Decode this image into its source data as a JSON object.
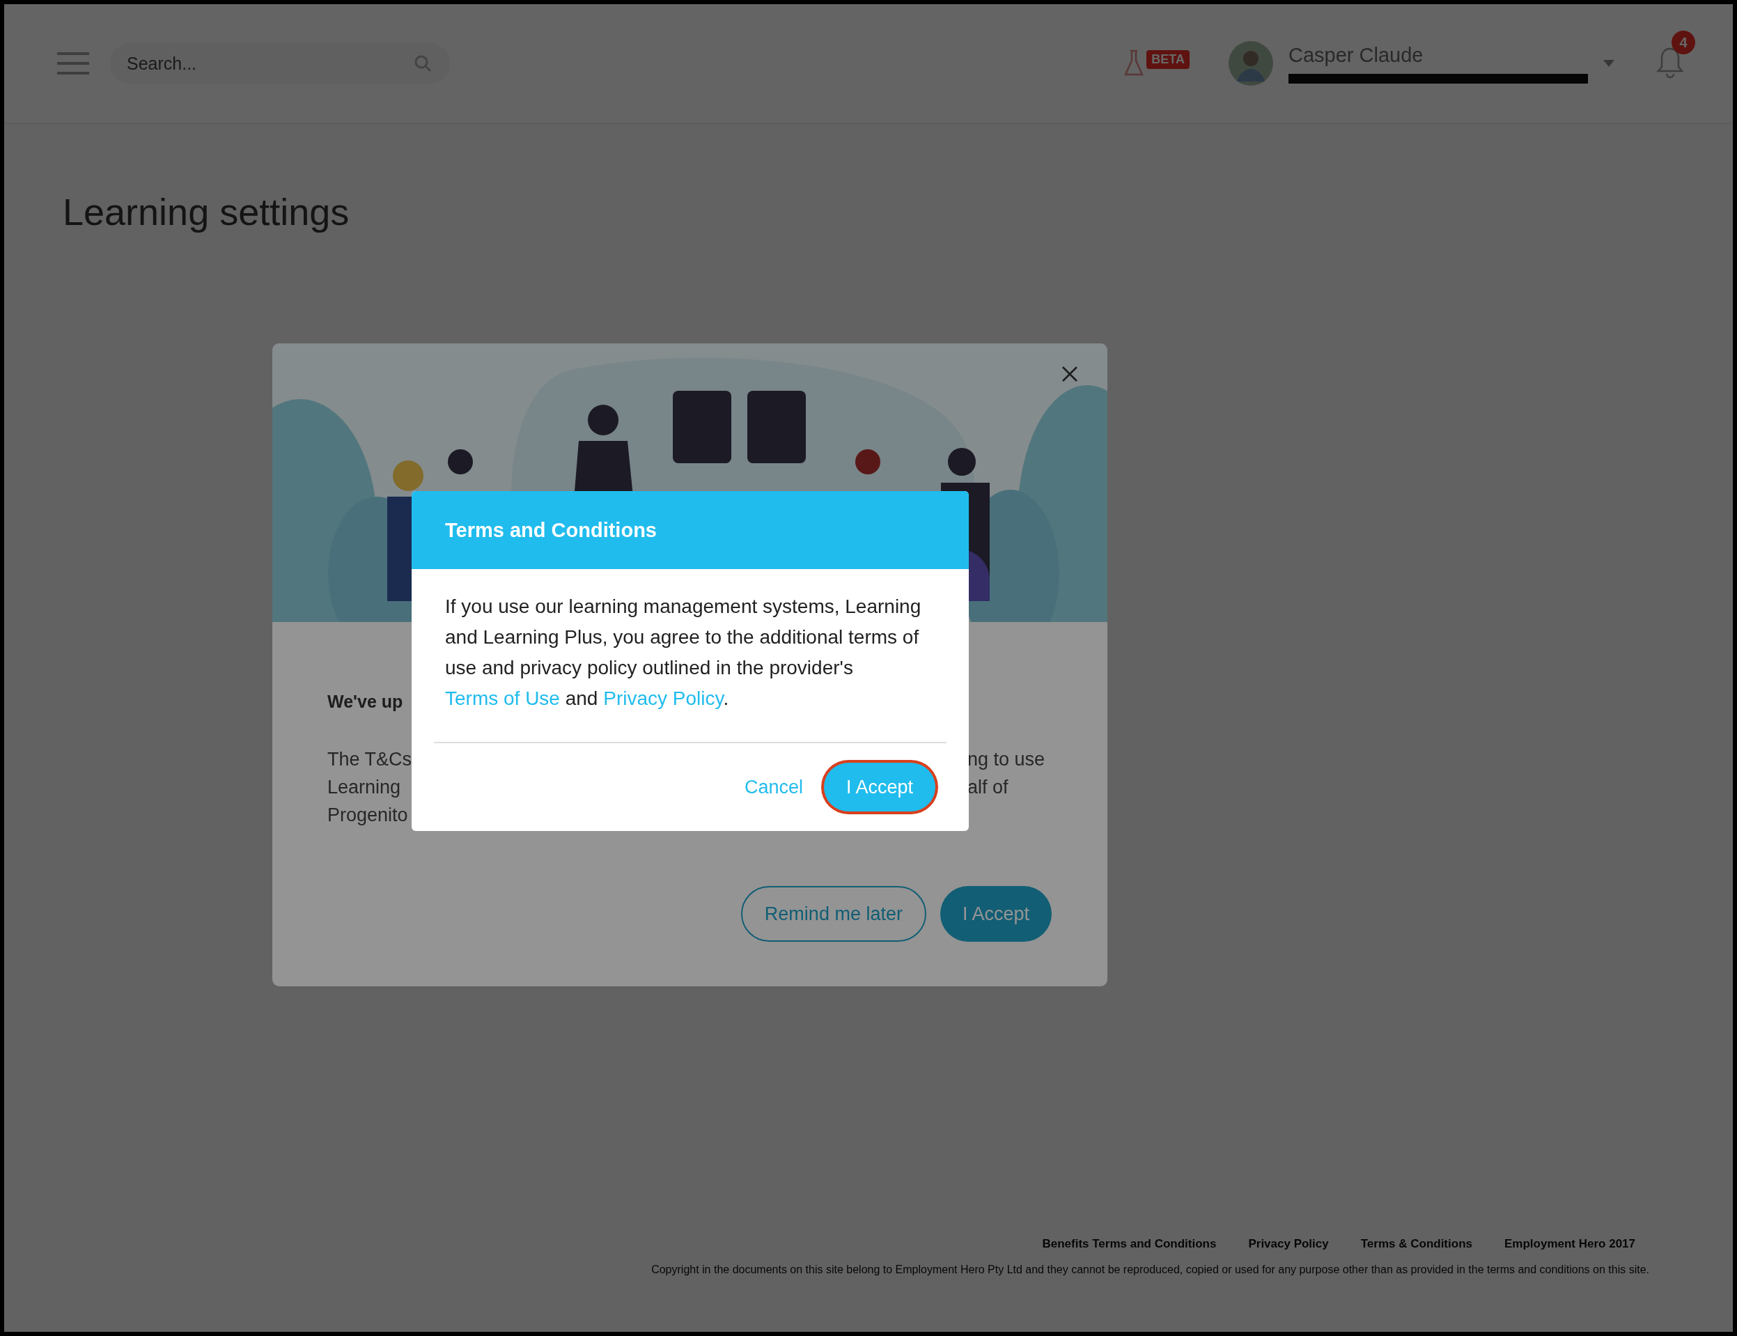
{
  "header": {
    "search": {
      "placeholder": "Search..."
    },
    "beta_badge": "BETA",
    "user": {
      "name": "Casper Claude"
    },
    "notifications": {
      "count": "4"
    }
  },
  "page": {
    "title": "Learning settings"
  },
  "background_dialog": {
    "heading": "We've up",
    "body_left": [
      "The T&Cs",
      "Learning",
      "Progenito"
    ],
    "body_right": [
      "ng to use",
      "alf of"
    ],
    "buttons": [
      {
        "label": "Remind me later",
        "kind": "outline"
      },
      {
        "label": "I Accept",
        "kind": "primary"
      }
    ]
  },
  "dialog": {
    "title": "Terms and Conditions",
    "body": [
      {
        "kind": "text",
        "text": "If you use our learning management systems, Learning and Learning Plus, you agree to the additional terms of use and privacy policy outlined in the provider's "
      },
      {
        "kind": "link",
        "text": "Terms of Use"
      },
      {
        "kind": "text",
        "text": " and "
      },
      {
        "kind": "link",
        "text": "Privacy Policy"
      },
      {
        "kind": "text",
        "text": "."
      }
    ],
    "buttons": [
      {
        "label": "Cancel",
        "kind": "link",
        "focused": false
      },
      {
        "label": "I Accept",
        "kind": "primary",
        "focused": true
      }
    ]
  },
  "footer": {
    "links": [
      "Benefits Terms and Conditions",
      "Privacy Policy",
      "Terms & Conditions",
      "Employment Hero 2017"
    ],
    "copyright": "Copyright in the documents on this site belong to Employment Hero Pty Ltd and they cannot be reproduced, copied or used for any purpose other than as provided in the terms and conditions on this site."
  }
}
